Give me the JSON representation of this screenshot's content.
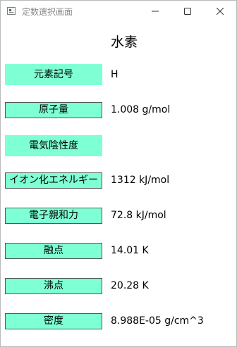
{
  "window": {
    "title": "定数選択画面",
    "icon": "app-window-icon",
    "controls": [
      "minimize-icon",
      "maximize-icon",
      "close-icon"
    ]
  },
  "element": {
    "name": "水素"
  },
  "properties": [
    {
      "label": "元素記号",
      "value": "H"
    },
    {
      "label": "原子量",
      "value": "1.008 g/mol"
    },
    {
      "label": "電気陰性度",
      "value": ""
    },
    {
      "label": "イオン化エネルギー",
      "value": "1312 kJ/mol"
    },
    {
      "label": "電子親和力",
      "value": "72.8 kJ/mol"
    },
    {
      "label": "融点",
      "value": "14.01 K"
    },
    {
      "label": "沸点",
      "value": "20.28 K"
    },
    {
      "label": "密度",
      "value": "8.988E-05 g/cm^3"
    }
  ],
  "colors": {
    "label_background": "#7fffd4",
    "label_border": "#555555",
    "window_background": "#ffffff"
  }
}
